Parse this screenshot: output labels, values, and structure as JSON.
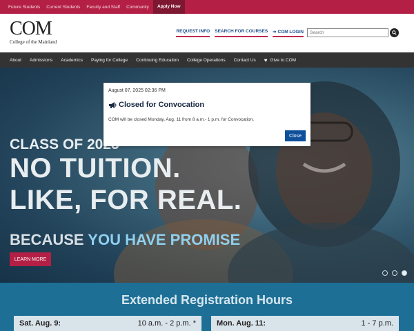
{
  "topbar": {
    "links": [
      "Future Students",
      "Current Students",
      "Faculty and Staff",
      "Community"
    ],
    "apply_label": "Apply Now"
  },
  "header": {
    "logo_main": "COM",
    "logo_sub": "College of the Mainland",
    "links": [
      "REQUEST INFO",
      "SEARCH FOR COURSES",
      "COM LOGIN"
    ],
    "search_placeholder": "Search"
  },
  "nav": {
    "items": [
      "About",
      "Admissions",
      "Academics",
      "Paying for College",
      "Continuing Education",
      "College Operations",
      "Contact Us"
    ],
    "give_label": "Give to COM"
  },
  "hero": {
    "class_line": "CLASS OF 2025",
    "line1": "NO TUITION.",
    "line2": "LIKE, FOR REAL.",
    "promise_prefix": "BECAUSE ",
    "promise_highlight": "YOU HAVE PROMISE",
    "cta_label": "LEARN MORE",
    "slides_total": 3,
    "active_slide": 3
  },
  "registration": {
    "title": "Extended Registration Hours",
    "rows": [
      {
        "day": "Sat. Aug. 9:",
        "hours": "10 a.m. - 2 p.m. *"
      },
      {
        "day": "Mon. Aug. 11:",
        "hours": "1 - 7 p.m."
      }
    ]
  },
  "modal": {
    "date": "August 07, 2025 02:36 PM",
    "title": "Closed for Convocation",
    "body": "COM will be closed Monday, Aug. 11 from 8 a.m.- 1 p.m. for Convocation.",
    "close_label": "Close",
    "icon": "megaphone-icon"
  },
  "colors": {
    "brand_red": "#b41f45",
    "nav_dark": "#333333",
    "link_blue": "#1e4f8a",
    "button_blue": "#0d4f9a",
    "reg_blue": "#1d6f96"
  }
}
